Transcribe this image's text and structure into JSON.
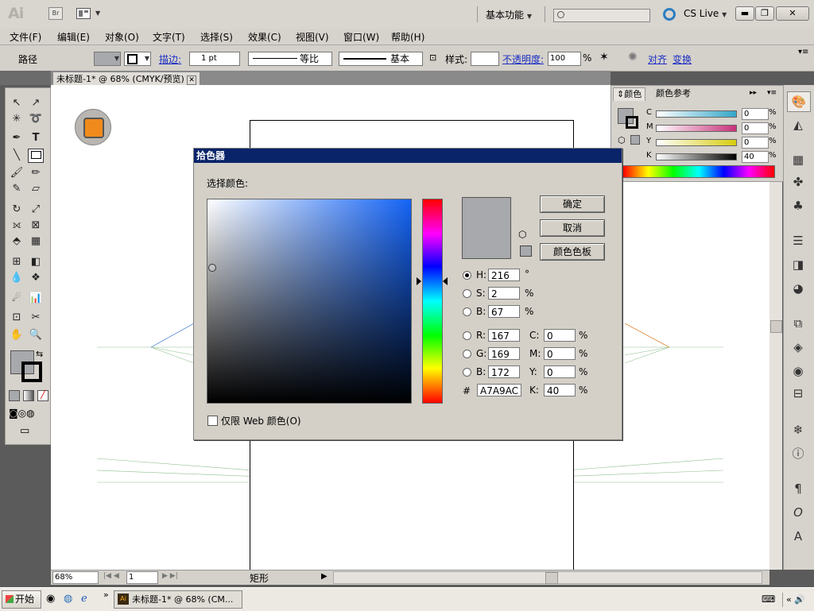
{
  "app": {
    "logo": "Ai",
    "bridge": "Br",
    "workspace": "基本功能",
    "cs_live": "CS Live"
  },
  "menu": [
    "文件(F)",
    "编辑(E)",
    "对象(O)",
    "文字(T)",
    "选择(S)",
    "效果(C)",
    "视图(V)",
    "窗口(W)",
    "帮助(H)"
  ],
  "control": {
    "selection": "路径",
    "stroke_label": "描边:",
    "stroke_weight": "1 pt",
    "stroke_profile": "等比",
    "brush": "基本",
    "style_label": "样式:",
    "opacity_label": "不透明度:",
    "opacity_value": "100",
    "opacity_unit": "%",
    "align": "对齐",
    "transform": "变换"
  },
  "document_tab": "未标题-1* @ 68% (CMYK/预览)",
  "color_panel": {
    "tab_color": "颜色",
    "tab_guide": "颜色参考",
    "sliders": [
      {
        "label": "C",
        "value": "0",
        "unit": "%",
        "color": "#33a6c8"
      },
      {
        "label": "M",
        "value": "0",
        "unit": "%",
        "color": "#c8327a"
      },
      {
        "label": "Y",
        "value": "0",
        "unit": "%",
        "color": "#d8cc10"
      },
      {
        "label": "K",
        "value": "40",
        "unit": "%",
        "color": "#555555"
      }
    ]
  },
  "dialog": {
    "title": "拾色器",
    "choose_label": "选择颜色:",
    "ok": "确定",
    "cancel": "取消",
    "swatches": "颜色色板",
    "web_only": "仅限 Web 颜色(O)",
    "h_label": "H:",
    "h_value": "216",
    "h_unit": "°",
    "s_label": "S:",
    "s_value": "2",
    "s_unit": "%",
    "b_label": "B:",
    "b_value": "67",
    "b_unit": "%",
    "r_label": "R:",
    "r_value": "167",
    "g_label": "G:",
    "g_value": "169",
    "bl_label": "B:",
    "bl_value": "172",
    "hex_label": "#",
    "hex_value": "A7A9AC",
    "c_label": "C:",
    "c_value": "0",
    "c_unit": "%",
    "m_label": "M:",
    "m_value": "0",
    "m_unit": "%",
    "y_label": "Y:",
    "y_value": "0",
    "y_unit": "%",
    "k_label": "K:",
    "k_value": "40",
    "k_unit": "%",
    "selected_color": "#a7a9ac",
    "hue_color": "#1463f5"
  },
  "status": {
    "zoom": "68%",
    "page": "1",
    "tool_name": "矩形"
  },
  "taskbar": {
    "start": "开始",
    "task": "未标题-1* @ 68% (CM..."
  }
}
